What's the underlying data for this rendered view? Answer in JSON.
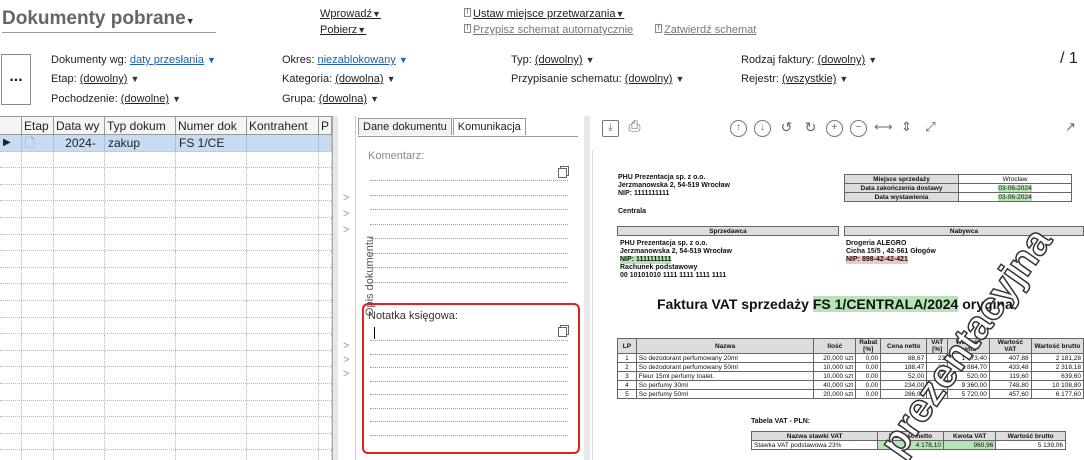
{
  "header": {
    "title": "Dokumenty pobrane",
    "menu": {
      "wprowadz": "Wprowadź",
      "pobierz": "Pobierz",
      "ustaw": "Ustaw miejsce przetwarzania",
      "przypisz": "Przypisz schemat automatycznie",
      "zatwierdz": "Zatwierdź schemat"
    },
    "page_count": "/ 1"
  },
  "filters": {
    "dokumenty_wg": {
      "label": "Dokumenty wg:",
      "value": "daty przesłania"
    },
    "etap": {
      "label": "Etap:",
      "value": "(dowolny)"
    },
    "pochodzenie": {
      "label": "Pochodzenie:",
      "value": "(dowolne)"
    },
    "okres": {
      "label": "Okres:",
      "value": "niezablokowany"
    },
    "kategoria": {
      "label": "Kategoria:",
      "value": "(dowolna)"
    },
    "grupa": {
      "label": "Grupa:",
      "value": "(dowolna)"
    },
    "typ": {
      "label": "Typ:",
      "value": "(dowolny)"
    },
    "przypisanie": {
      "label": "Przypisanie schematu:",
      "value": "(dowolny)"
    },
    "rodzaj": {
      "label": "Rodzaj faktury:",
      "value": "(dowolny)"
    },
    "rejestr": {
      "label": "Rejestr:",
      "value": "(wszystkie)"
    }
  },
  "more_button": "...",
  "grid": {
    "columns": [
      "Etap",
      "Data wy",
      "Typ dokum",
      "Numer dok",
      "Kontrahent",
      "P"
    ],
    "rows": [
      {
        "data": "2024-",
        "typ": "zakup",
        "numer": "FS 1/CE"
      }
    ]
  },
  "middle": {
    "tabs": [
      "Dane dokumentu",
      "Komunikacja"
    ],
    "sidebar_label": "Opis dokumentu",
    "komentarz_label": "Komentarz:",
    "notatka_label": "Notatka księgowa:"
  },
  "invoice": {
    "seller_block": [
      "PHU Prezentacja sp. z o.o.",
      "Jerzmanowska 2, 54-519 Wrocław",
      "NIP: 1111111111",
      "Centrala"
    ],
    "meta": [
      {
        "label": "Miejsce sprzedaży",
        "value": "Wrocław"
      },
      {
        "label": "Data zakończenia dostawy",
        "value": "03-06-2024"
      },
      {
        "label": "Data wystawienia",
        "value": "03-06-2024"
      }
    ],
    "sprzedawca_header": "Sprzedawca",
    "nabywca_header": "Nabywca",
    "sprzedawca": [
      "PHU Prezentacja sp. z o.o.",
      "Jerzmanowska 2, 54-519 Wrocław",
      "NIP: 1111111111",
      "Rachunek podstawowy",
      "00 10101010 1111 1111 1111 1111"
    ],
    "nabywca": [
      "Drogeria ALEGRO",
      "Cicha 15/5 , 42-561 Głogów",
      "NIP: 898-42-42-421"
    ],
    "title_prefix": "Faktura VAT sprzedaży ",
    "title_number": "FS 1/CENTRALA/2024",
    "title_suffix": " oryginał",
    "items_header": [
      "LP",
      "Nazwa",
      "Ilość",
      "Rabat [%]",
      "Cena netto",
      "VAT [%]",
      "Wartość netto",
      "Wartość VAT",
      "Wartość brutto"
    ],
    "items": [
      [
        "1",
        "So dezodorant perfumowany 20ml",
        "20,000 szt",
        "0,00",
        "88,67",
        "23",
        "1 773,40",
        "407,88",
        "2 181,28"
      ],
      [
        "2",
        "So dezodorant perfumowany 50ml",
        "10,000 szt",
        "0,00",
        "188,47",
        "23",
        "1 884,70",
        "433,48",
        "2 318,18"
      ],
      [
        "3",
        "Fleur 15ml perfumy toalet.",
        "10,000 szt",
        "0,00",
        "52,00",
        "23",
        "520,00",
        "119,60",
        "639,60"
      ],
      [
        "4",
        "So perfumy 30ml",
        "40,000 szt",
        "0,00",
        "234,00",
        "8",
        "9 360,00",
        "748,80",
        "10 108,80"
      ],
      [
        "5",
        "So perfumy 50ml",
        "20,000 szt",
        "0,00",
        "286,00",
        "8",
        "5 720,00",
        "457,60",
        "6 177,60"
      ]
    ],
    "vat_table_title": "Tabela VAT - PLN:",
    "vat_header": [
      "Nazwa stawki VAT",
      "Wartość netto",
      "Kwota VAT",
      "Wartość brutto"
    ],
    "vat_rows": [
      [
        "Stawka VAT podstawowa 23%",
        "4 178,10",
        "960,96",
        "5 139,06"
      ]
    ],
    "watermark": "prezentacyjna"
  }
}
